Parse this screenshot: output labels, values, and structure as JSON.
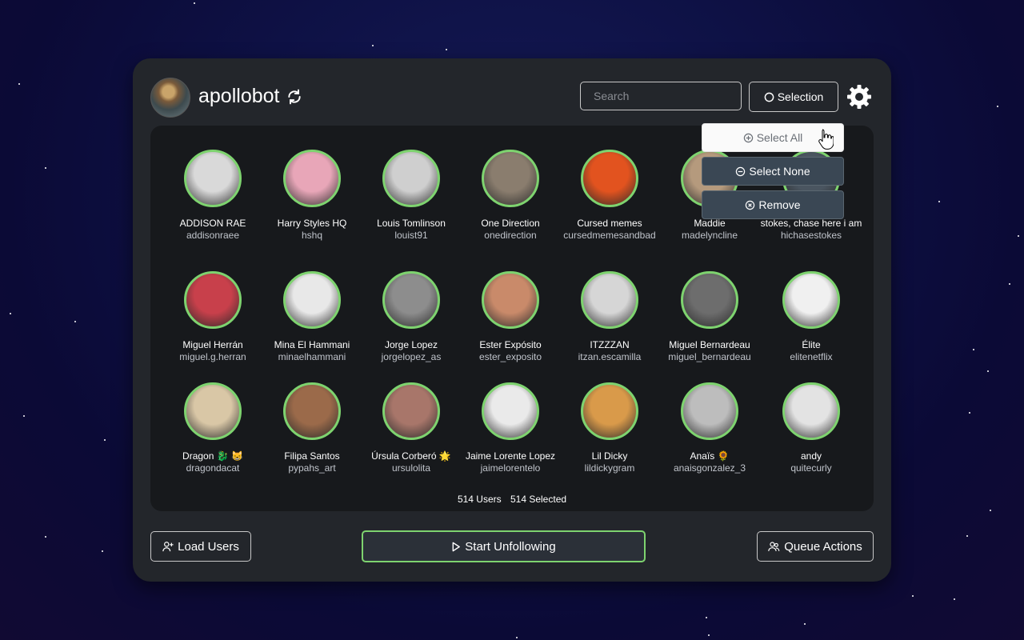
{
  "header": {
    "username": "apollobot",
    "search_placeholder": "Search",
    "selection_label": "Selection"
  },
  "dropdown": {
    "select_all": "Select All",
    "select_none": "Select None",
    "remove": "Remove"
  },
  "users": [
    {
      "name": "ADDISON RAE",
      "handle": "addisonraee",
      "color": "#d9d9d9"
    },
    {
      "name": "Harry Styles HQ",
      "handle": "hshq",
      "color": "#e8a6b8"
    },
    {
      "name": "Louis Tomlinson",
      "handle": "louist91",
      "color": "#cfcfcf"
    },
    {
      "name": "One Direction",
      "handle": "onedirection",
      "color": "#8a7d6e"
    },
    {
      "name": "Cursed memes",
      "handle": "cursedmemesandbad",
      "color": "#e2531f"
    },
    {
      "name": "Maddie",
      "handle": "madelyncline",
      "color": "#b59a7d"
    },
    {
      "name": "stokes, chase here i am",
      "handle": "hichasestokes",
      "color": "#4a5560"
    },
    {
      "name": "Miguel Herrán",
      "handle": "miguel.g.herran",
      "color": "#c8404b"
    },
    {
      "name": "Mina El Hammani",
      "handle": "minaelhammani",
      "color": "#e8e8e8"
    },
    {
      "name": "Jorge Lopez",
      "handle": "jorgelopez_as",
      "color": "#8d8d8d"
    },
    {
      "name": "Ester Expósito",
      "handle": "ester_exposito",
      "color": "#c98a6a"
    },
    {
      "name": "ITZZZAN",
      "handle": "itzan.escamilla",
      "color": "#d6d6d6"
    },
    {
      "name": "Miguel Bernardeau",
      "handle": "miguel_bernardeau",
      "color": "#6d6d6d"
    },
    {
      "name": "Élite",
      "handle": "elitenetflix",
      "color": "#f0f0f0"
    },
    {
      "name": "Dragon 🐉 😸",
      "handle": "dragondacat",
      "color": "#d9c7a6"
    },
    {
      "name": "Filipa Santos",
      "handle": "pypahs_art",
      "color": "#9b6a4a"
    },
    {
      "name": "Úrsula Corberó 🌟",
      "handle": "ursulolita",
      "color": "#a8766a"
    },
    {
      "name": "Jaime Lorente Lopez",
      "handle": "jaimelorentelo",
      "color": "#eaeaea"
    },
    {
      "name": "Lil Dicky",
      "handle": "lildickygram",
      "color": "#d99a4a"
    },
    {
      "name": "Anaïs 🌻",
      "handle": "anaisgonzalez_3",
      "color": "#bdbdbd"
    },
    {
      "name": "andy",
      "handle": "quitecurly",
      "color": "#e3e3e3"
    }
  ],
  "footer": {
    "users_count": "514 Users",
    "selected_count": "514 Selected"
  },
  "buttons": {
    "load_users": "Load Users",
    "start_unfollowing": "Start Unfollowing",
    "queue_actions": "Queue Actions"
  },
  "colors": {
    "accent": "#7ed36f",
    "panel": "#23262b",
    "grid_bg": "#17191c"
  }
}
